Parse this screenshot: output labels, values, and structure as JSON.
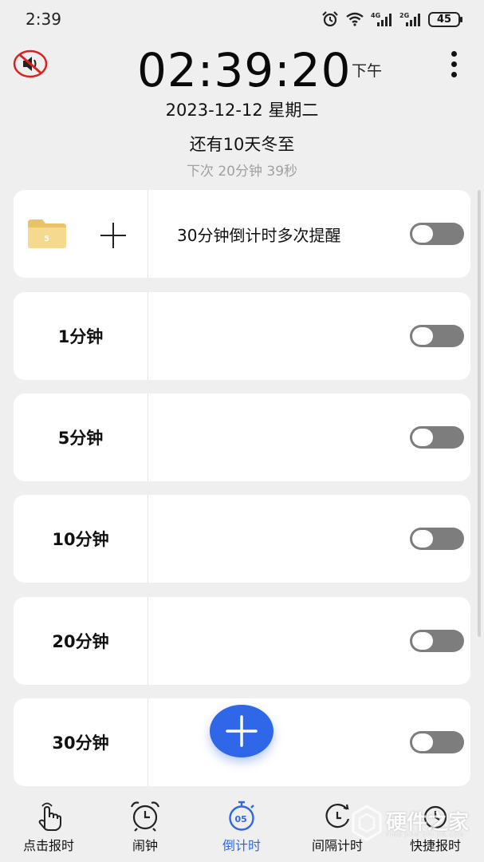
{
  "status_bar": {
    "time": "2:39",
    "net_4g": "4G",
    "net_2g": "2G",
    "battery": "45"
  },
  "header": {
    "clock": "02:39:20",
    "ampm": "下午",
    "date": "2023-12-12 星期二",
    "festival": "还有10天冬至",
    "next_alarm": "下次  20分钟 39秒"
  },
  "list": {
    "folder_badge": "5",
    "items": [
      {
        "label": "",
        "title": "30分钟倒计时多次提醒",
        "enabled": false
      },
      {
        "label": "1分钟",
        "title": "",
        "enabled": false
      },
      {
        "label": "5分钟",
        "title": "",
        "enabled": false
      },
      {
        "label": "10分钟",
        "title": "",
        "enabled": false
      },
      {
        "label": "20分钟",
        "title": "",
        "enabled": false
      },
      {
        "label": "30分钟",
        "title": "",
        "enabled": false
      }
    ]
  },
  "bottom_nav": [
    {
      "label": "点击报时",
      "icon": "tap-hand-icon"
    },
    {
      "label": "闹钟",
      "icon": "alarm-clock-icon"
    },
    {
      "label": "倒计时",
      "icon": "stopwatch-icon",
      "active": true
    },
    {
      "label": "间隔计时",
      "icon": "interval-timer-icon"
    },
    {
      "label": "快捷报时",
      "icon": "quick-announce-icon"
    }
  ],
  "watermark": {
    "text": "硬件之家",
    "sub": "YING JIAN ZHI JIA.COM"
  },
  "colors": {
    "accent": "#2f67e8",
    "toggle_off": "#7d7d7d",
    "background": "#efefef",
    "muted_red": "#e02020"
  }
}
